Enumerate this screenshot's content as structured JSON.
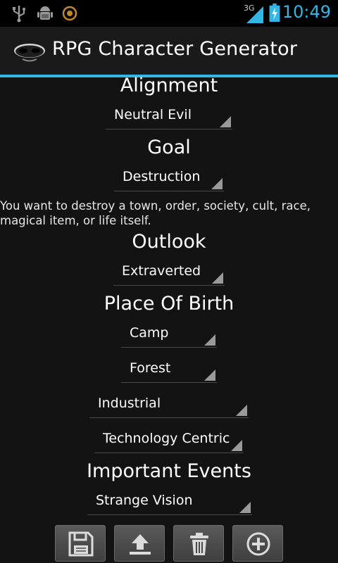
{
  "status_bar": {
    "time": "10:49",
    "network": "3G",
    "icons": [
      "usb-icon",
      "android-debug-icon",
      "sync-icon",
      "signal-icon",
      "battery-charging-icon"
    ]
  },
  "app": {
    "title": "RPG Character Generator",
    "icon": "mask-icon"
  },
  "alignment": {
    "heading": "Alignment",
    "value": "Neutral Evil"
  },
  "goal": {
    "heading": "Goal",
    "value": "Destruction",
    "description": "You want to destroy a town, order, society, cult, race, magical item, or life itself."
  },
  "outlook": {
    "heading": "Outlook",
    "value": "Extraverted"
  },
  "place_of_birth": {
    "heading": "Place Of Birth",
    "values": [
      "Camp",
      "Forest",
      "Industrial",
      "Technology Centric"
    ]
  },
  "important_events": {
    "heading": "Important Events",
    "value": "Strange Vision"
  },
  "toolbar": {
    "buttons": [
      "save-icon",
      "share-upload-icon",
      "delete-icon",
      "add-icon"
    ]
  },
  "colors": {
    "accent": "#33b5e5",
    "background": "#131313"
  }
}
